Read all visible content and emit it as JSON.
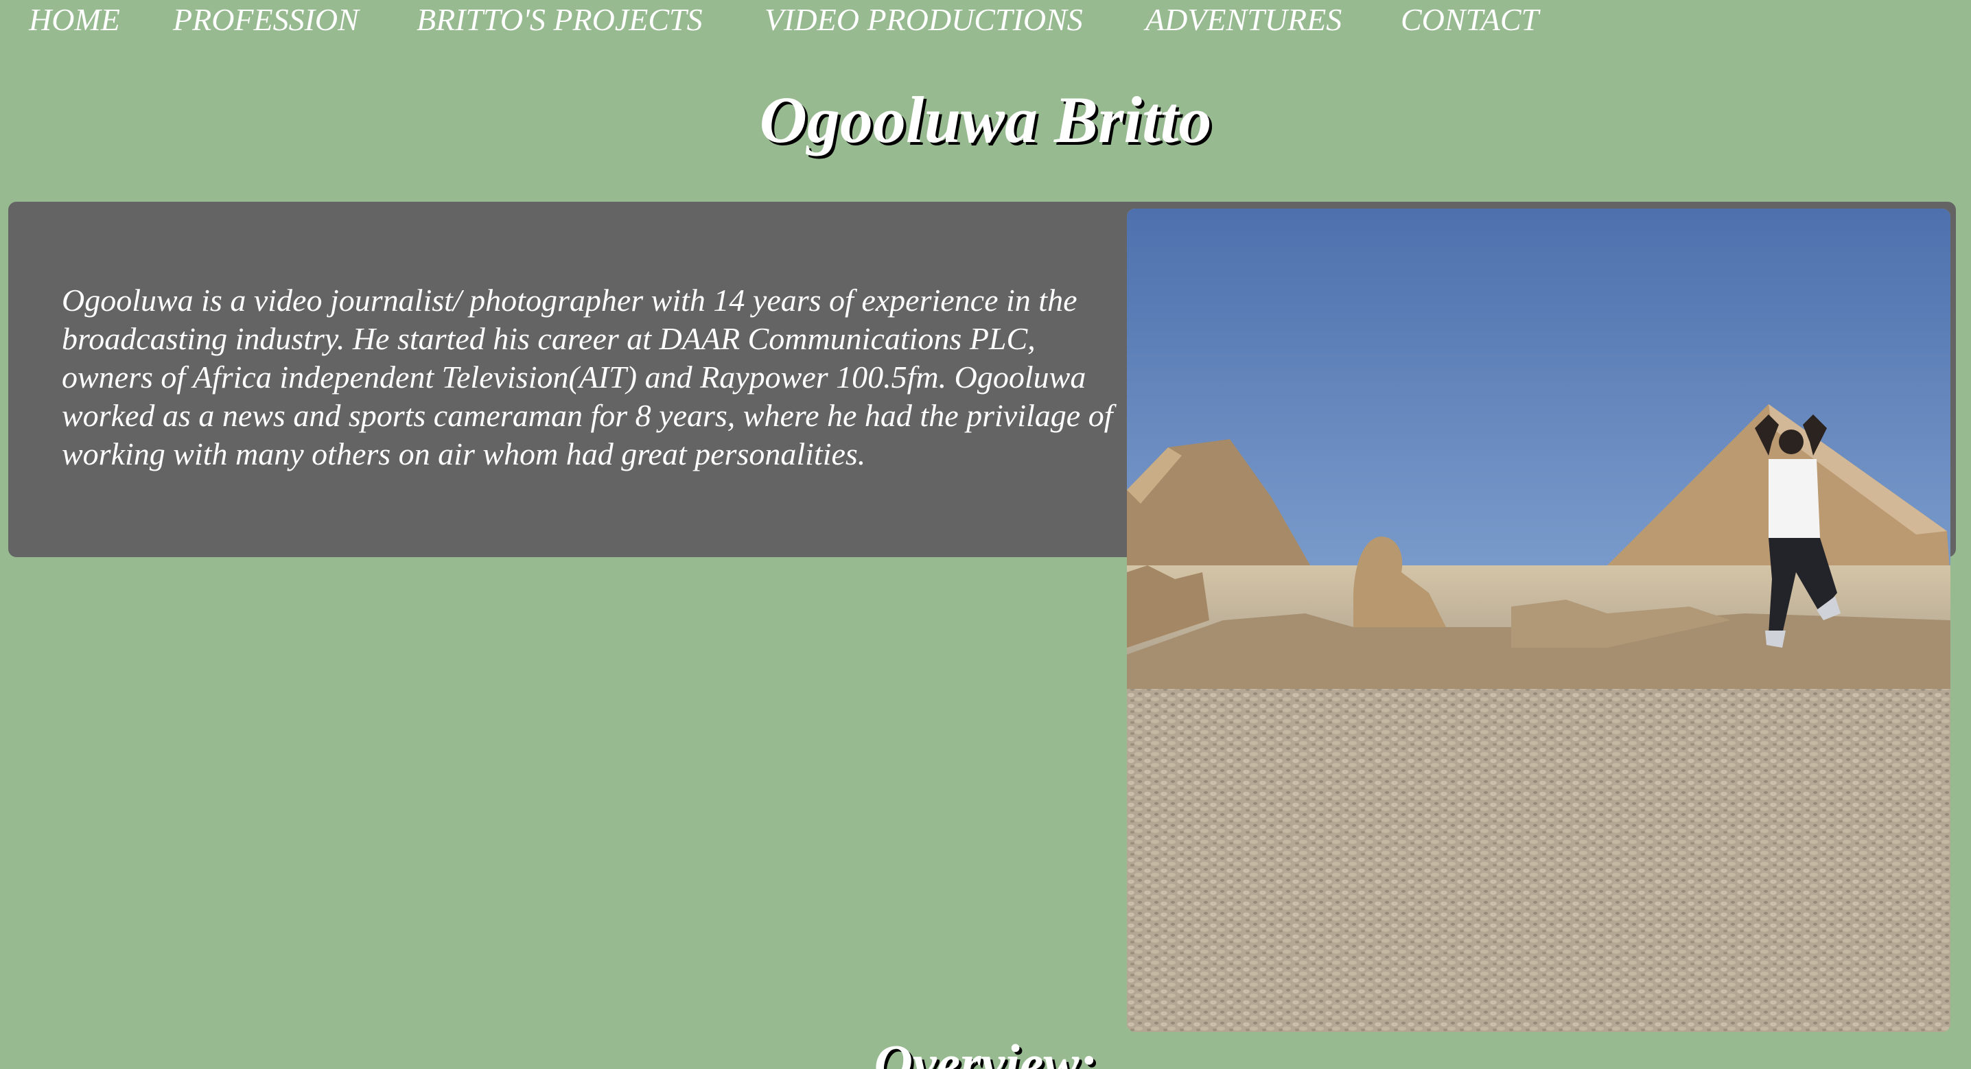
{
  "nav": {
    "items": [
      {
        "label": "HOME"
      },
      {
        "label": "PROFESSION"
      },
      {
        "label": "BRITTO'S PROJECTS"
      },
      {
        "label": "VIDEO PRODUCTIONS"
      },
      {
        "label": "ADVENTURES"
      },
      {
        "label": "CONTACT"
      }
    ]
  },
  "header": {
    "title": "Ogooluwa Britto"
  },
  "intro": {
    "text": "Ogooluwa is a video journalist/ photographer with 14 years of experience in the broadcasting industry. He started his career at DAAR Communications PLC, owners of Africa independent Television(AIT) and Raypower 100.5fm. Ogooluwa worked as a news and sports cameraman for 8 years, where he had the privilage of working with many others on air whom had great personalities."
  },
  "photo": {
    "icon": "pyramids-photo"
  },
  "overview": {
    "heading": "Overview:"
  },
  "colors": {
    "page_background": "#97ba91",
    "card_background": "#646464",
    "text": "#ffffff",
    "title_shadow": "#000000"
  }
}
